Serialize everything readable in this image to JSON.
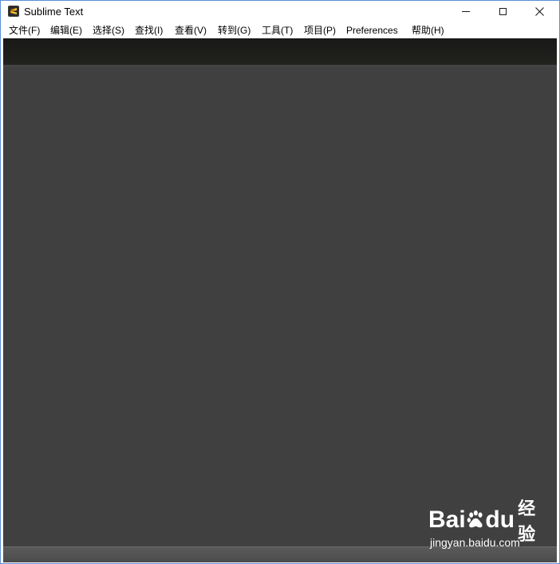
{
  "window": {
    "title": "Sublime Text"
  },
  "menu": [
    {
      "label": "文件(F)"
    },
    {
      "label": "编辑(E)"
    },
    {
      "label": "选择(S)"
    },
    {
      "label": "查找(I)"
    },
    {
      "label": "查看(V)"
    },
    {
      "label": "转到(G)"
    },
    {
      "label": "工具(T)"
    },
    {
      "label": "项目(P)"
    },
    {
      "label": "Preferences"
    },
    {
      "label": "帮助(H)"
    }
  ],
  "icons": {
    "app": "sublime-text-icon",
    "minimize": "minimize-icon",
    "maximize": "maximize-icon",
    "close": "close-icon"
  },
  "colors": {
    "tab_strip": "#1c1c1a",
    "editor_bg": "#404040",
    "status_bar": "#4f4f4f"
  },
  "watermark": {
    "logo_left": "Bai",
    "logo_right": "du",
    "logo_suffix": "经验",
    "url": "jingyan.baidu.com"
  }
}
